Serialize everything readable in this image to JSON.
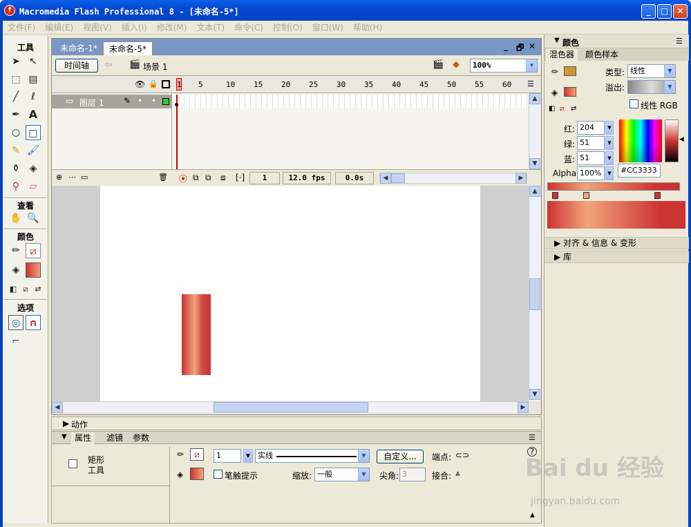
{
  "window": {
    "title": "Macromedia Flash Professional 8 - [未命名-5*]",
    "minimize": "_",
    "maximize": "□",
    "close": "✕"
  },
  "menu": [
    "文件(F)",
    "编辑(E)",
    "视图(V)",
    "插入(I)",
    "修改(M)",
    "文本(T)",
    "命令(C)",
    "控制(O)",
    "窗口(W)",
    "帮助(H)"
  ],
  "tools": {
    "title": "工具",
    "view": "查看",
    "colors": "颜色",
    "options": "选项"
  },
  "doc": {
    "tabs": [
      "未命名-1*",
      "未命名-5*"
    ],
    "active_tab": 1,
    "timeline_button": "时间轴",
    "scene": "场景 1",
    "zoom": "100%",
    "ctrl_min": "_",
    "ctrl_restore": "🗗",
    "ctrl_close": "✕"
  },
  "timeline": {
    "frame_numbers": [
      "1",
      "5",
      "10",
      "15",
      "20",
      "25",
      "30",
      "35",
      "40",
      "45",
      "50",
      "55",
      "60"
    ],
    "layer": "图层 1",
    "current_frame": "1",
    "fps": "12.0 fps",
    "time": "0.0s"
  },
  "actions_panel": {
    "title": "动作"
  },
  "properties": {
    "tabs": [
      "属性",
      "滤镜",
      "参数"
    ],
    "tool_name": "矩形\n工具",
    "stroke_height": "1",
    "stroke_style": "实线",
    "custom_button": "自定义...",
    "endpoint_label": "端点:",
    "hint_label": "笔触提示",
    "scale_label": "缩放:",
    "scale_value": "一般",
    "miter_label": "尖角:",
    "miter_value": "3",
    "join_label": "接合:"
  },
  "color_panel": {
    "title": "颜色",
    "tabs": [
      "混色器",
      "颜色样本"
    ],
    "type_label": "类型:",
    "type_value": "线性",
    "overflow_label": "溢出:",
    "linear_rgb": "线性 RGB",
    "red_label": "红:",
    "red": "204",
    "green_label": "绿:",
    "green": "51",
    "blue_label": "蓝:",
    "blue": "51",
    "alpha_label": "Alpha:",
    "alpha": "100%",
    "hex": "#CC3333",
    "colors": {
      "fill": "#CC3333",
      "light": "#F2A47A",
      "stroke": "#CC9933"
    }
  },
  "collapsed_panels": [
    "对齐 & 信息 & 变形",
    "库"
  ],
  "watermark": {
    "main": "Bai du 经验",
    "sub": "jingyan.baidu.com"
  }
}
